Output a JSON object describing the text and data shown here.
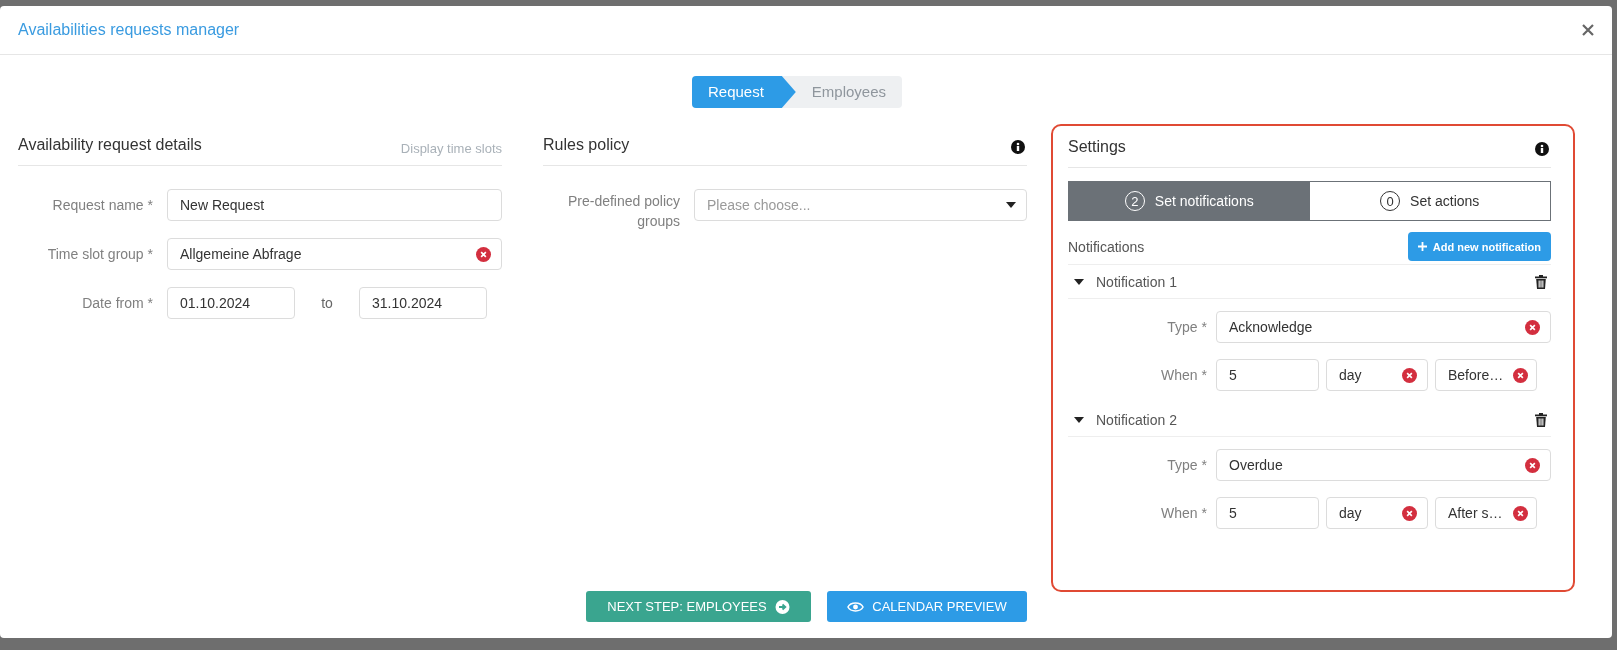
{
  "dialog": {
    "title": "Availabilities requests manager"
  },
  "steps": [
    {
      "label": "Request",
      "selected": true
    },
    {
      "label": "Employees",
      "selected": false
    }
  ],
  "details": {
    "heading": "Availability request details",
    "link": "Display time slots",
    "fields": [
      {
        "kind": "text",
        "label": "Request name *",
        "value": "New Request",
        "clearable": false
      },
      {
        "kind": "text",
        "label": "Time slot group *",
        "value": "Allgemeine Abfrage",
        "clearable": true
      },
      {
        "kind": "range",
        "label": "Date from *",
        "value": "01.10.2024",
        "separator": "to",
        "value_to": "31.10.2024"
      }
    ]
  },
  "rules": {
    "heading": "Rules policy",
    "field_label": "Pre-defined policy groups",
    "placeholder": "Please choose..."
  },
  "settings": {
    "heading": "Settings",
    "tabs": [
      {
        "count": "2",
        "label": "Set notifications",
        "selected": true
      },
      {
        "count": "0",
        "label": "Set actions",
        "selected": false
      }
    ],
    "notifications_label": "Notifications",
    "add_button": "Add new notification",
    "items": [
      {
        "title": "Notification 1",
        "expanded": true,
        "type_label": "Type *",
        "type": "Acknowledge",
        "when_label": "When *",
        "amount": "5",
        "unit": "day",
        "relation": "Before…"
      },
      {
        "title": "Notification 2",
        "expanded": true,
        "type_label": "Type *",
        "type": "Overdue",
        "when_label": "When *",
        "amount": "5",
        "unit": "day",
        "relation": "After s…"
      }
    ]
  },
  "footer_buttons": [
    {
      "kind": "next",
      "label": "NEXT STEP: EMPLOYEES"
    },
    {
      "kind": "preview",
      "label": "CALENDAR PREVIEW"
    }
  ]
}
